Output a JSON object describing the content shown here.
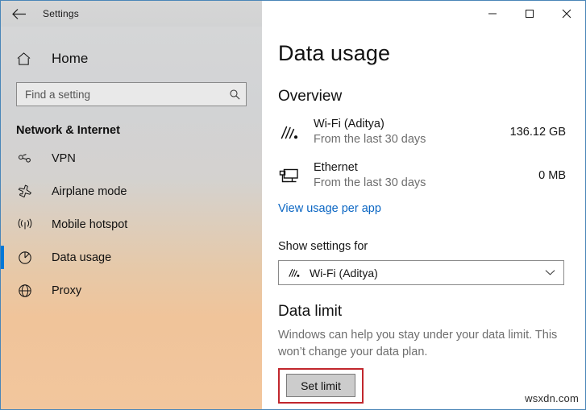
{
  "window": {
    "title": "Settings",
    "back_icon": "back-arrow-icon",
    "controls": {
      "minimize": "minimize-icon",
      "maximize": "maximize-icon",
      "close": "close-icon"
    }
  },
  "sidebar": {
    "home": {
      "label": "Home",
      "icon": "home-icon"
    },
    "search": {
      "value": "",
      "placeholder": "Find a setting",
      "icon": "search-icon"
    },
    "category": "Network & Internet",
    "items": [
      {
        "label": "VPN",
        "icon": "vpn-icon",
        "selected": false
      },
      {
        "label": "Airplane mode",
        "icon": "airplane-icon",
        "selected": false
      },
      {
        "label": "Mobile hotspot",
        "icon": "hotspot-icon",
        "selected": false
      },
      {
        "label": "Data usage",
        "icon": "pie-chart-icon",
        "selected": true
      },
      {
        "label": "Proxy",
        "icon": "globe-icon",
        "selected": false
      }
    ]
  },
  "main": {
    "page_title": "Data usage",
    "overview": {
      "heading": "Overview",
      "rows": [
        {
          "icon": "wifi-icon",
          "name": "Wi-Fi (Aditya)",
          "subtitle": "From the last 30 days",
          "value": "136.12 GB"
        },
        {
          "icon": "ethernet-icon",
          "name": "Ethernet",
          "subtitle": "From the last 30 days",
          "value": "0 MB"
        }
      ],
      "link": "View usage per app"
    },
    "show_settings": {
      "label": "Show settings for",
      "selected": "Wi-Fi (Aditya)",
      "icon": "wifi-icon",
      "chevron": "chevron-down-icon",
      "options": [
        "Wi-Fi (Aditya)"
      ]
    },
    "data_limit": {
      "heading": "Data limit",
      "description": "Windows can help you stay under your data limit. This won’t change your data plan.",
      "button_label": "Set limit",
      "highlight_color": "#c1272d"
    }
  },
  "watermark": "wsxdn.com",
  "colors": {
    "accent": "#0078d7",
    "link": "#0b66c3",
    "highlight": "#c1272d",
    "window_border": "#4a86b8"
  }
}
